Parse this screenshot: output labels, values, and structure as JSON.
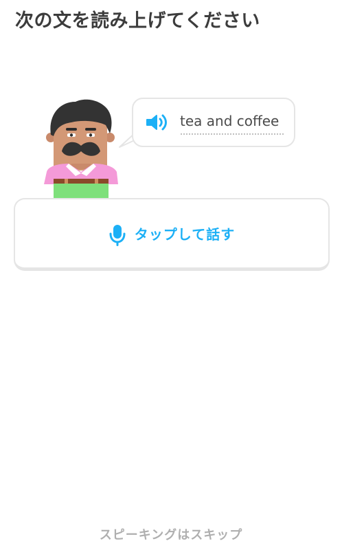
{
  "header": {
    "title": "次の文を読み上げてください"
  },
  "prompt": {
    "text": "tea and coffee",
    "speaker_icon": "speaker-icon"
  },
  "speak_button": {
    "label": "タップして話す",
    "icon": "microphone-icon"
  },
  "footer": {
    "skip_label": "スピーキングはスキップ"
  },
  "colors": {
    "accent": "#1cb0f6",
    "title": "#3c3c3c",
    "border": "#e5e5e5",
    "skip": "#afafaf"
  }
}
